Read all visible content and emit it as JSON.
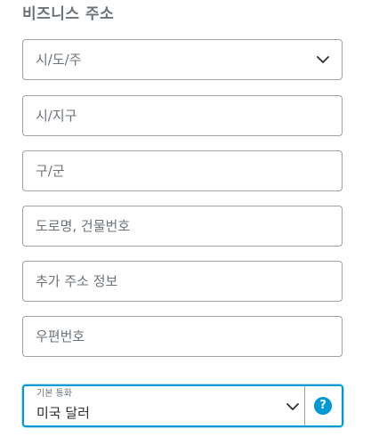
{
  "section": {
    "title": "비즈니스 주소"
  },
  "address": {
    "state_select": {
      "label": "시/도/주",
      "icon": "chevron-down-icon"
    },
    "city": {
      "placeholder": "시/지구"
    },
    "district": {
      "placeholder": "구/군"
    },
    "street": {
      "placeholder": "도로명, 건물번호"
    },
    "extra": {
      "placeholder": "추가 주소 정보"
    },
    "postal": {
      "placeholder": "우편번호"
    }
  },
  "currency": {
    "caption": "기본 통화",
    "value": "미국 달러",
    "icon": "chevron-down-icon",
    "help_label": "?",
    "help_icon": "question-circle-icon"
  },
  "colors": {
    "accent": "#0099d6",
    "border": "#9da3a6",
    "placeholder": "#6c7378",
    "text": "#2c2e2f"
  }
}
